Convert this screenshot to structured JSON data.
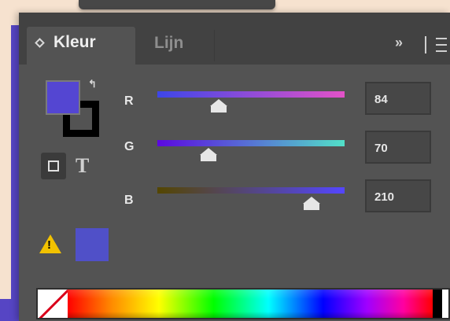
{
  "panel": {
    "tabs": [
      {
        "label": "Kleur",
        "active": true
      },
      {
        "label": "Lijn",
        "active": false
      }
    ],
    "menu_arrows_icon": "double-chevron-right",
    "menu_icon": "hamburger-menu"
  },
  "fill_stroke": {
    "fill_color": "#5446d2",
    "stroke_color": "#000000",
    "swap_icon": "swap-arrow",
    "mode_container_icon": "square-outline",
    "mode_text_label": "T"
  },
  "channels": [
    {
      "label": "R",
      "value": "84",
      "fraction": 0.329,
      "gradient_from": "#3d46e8",
      "gradient_to": "#e352c8"
    },
    {
      "label": "G",
      "value": "70",
      "fraction": 0.275,
      "gradient_from": "#5b08e0",
      "gradient_to": "#52e0c8"
    },
    {
      "label": "B",
      "value": "210",
      "fraction": 0.824,
      "gradient_from": "#544600",
      "gradient_to": "#5446ff"
    }
  ],
  "warning": {
    "icon": "warning-triangle",
    "mark": "!",
    "websafe_color": "#5050c8"
  },
  "spectrum": {
    "none_swatch": "none-slash",
    "black": "#000000",
    "white": "#ffffff"
  }
}
